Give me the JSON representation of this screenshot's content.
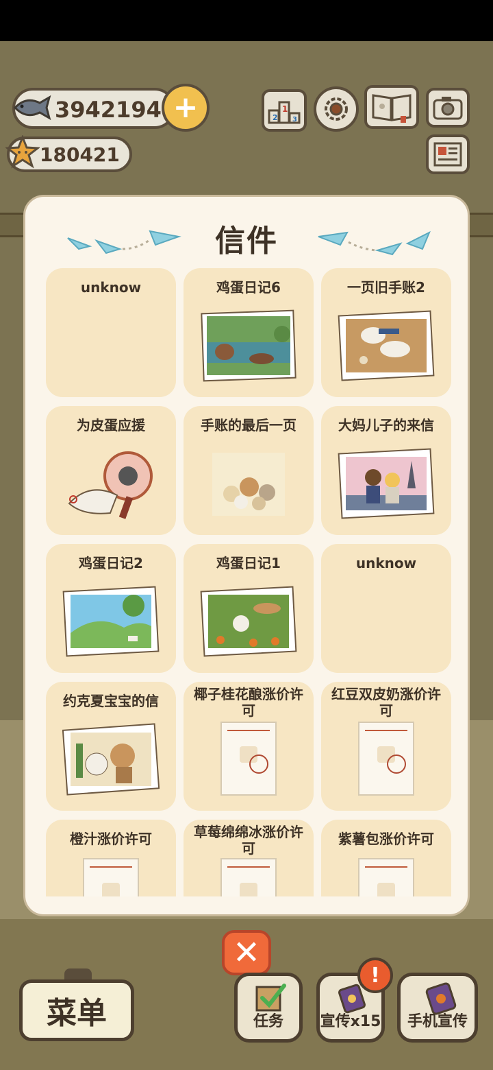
{
  "hud": {
    "fish_count": "3942194",
    "star_count": "180421",
    "plus_label": "+",
    "icons": [
      "fish-icon",
      "star-icon",
      "ranking-icon",
      "settings-icon",
      "book-icon",
      "camera-icon",
      "newspaper-icon"
    ]
  },
  "modal": {
    "title": "信件",
    "items": [
      {
        "title": "unknow",
        "kind": "empty"
      },
      {
        "title": "鸡蛋日记6",
        "kind": "photo"
      },
      {
        "title": "一页旧手账2",
        "kind": "photo"
      },
      {
        "title": "为皮蛋应援",
        "kind": "illustration"
      },
      {
        "title": "手账的最后一页",
        "kind": "illustration"
      },
      {
        "title": "大妈儿子的来信",
        "kind": "photo"
      },
      {
        "title": "鸡蛋日记2",
        "kind": "photo"
      },
      {
        "title": "鸡蛋日记1",
        "kind": "photo"
      },
      {
        "title": "unknow",
        "kind": "empty"
      },
      {
        "title": "约克夏宝宝的信",
        "kind": "photo"
      },
      {
        "title": "椰子桂花酿涨价许可",
        "kind": "document"
      },
      {
        "title": "红豆双皮奶涨价许可",
        "kind": "document"
      },
      {
        "title": "橙汁涨价许可",
        "kind": "document"
      },
      {
        "title": "草莓绵绵冰涨价许可",
        "kind": "document"
      },
      {
        "title": "紫薯包涨价许可",
        "kind": "document"
      }
    ]
  },
  "close_label": "✕",
  "bottom": {
    "menu": "菜单",
    "task": "任务",
    "promo": "宣传x15",
    "phone_promo": "手机宣传",
    "badge": "!"
  }
}
